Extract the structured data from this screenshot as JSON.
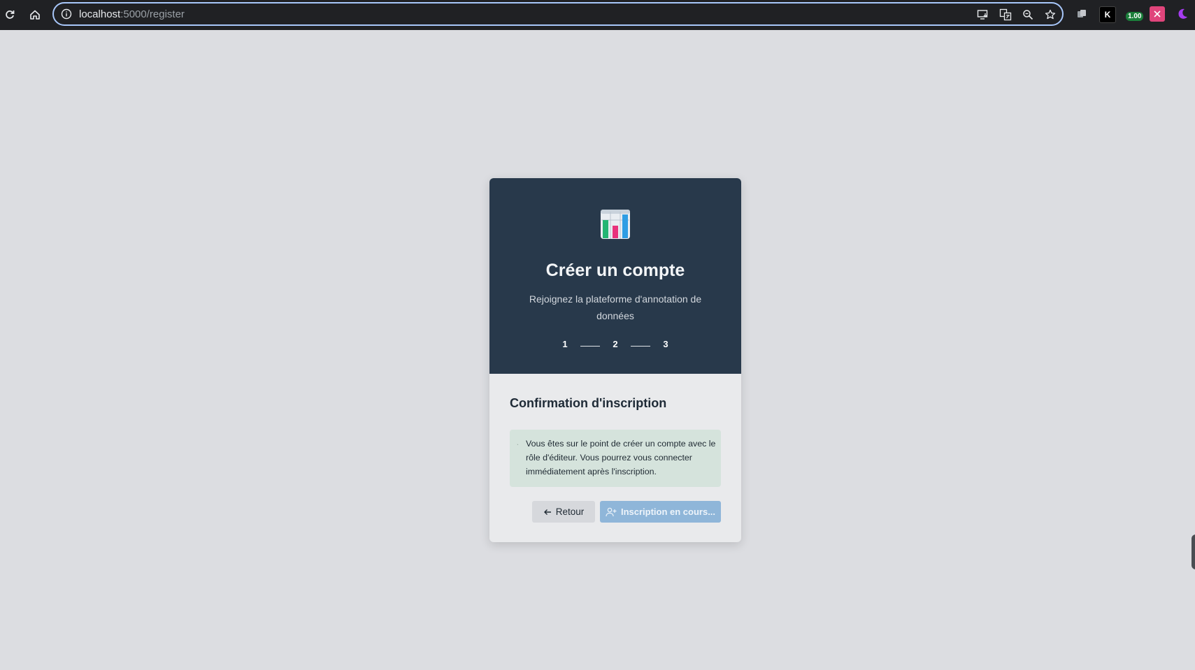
{
  "browser": {
    "url_host": "localhost",
    "url_path": ":5000/register",
    "extension_badge": "1.00",
    "colors": {
      "toolbar": "#202124",
      "omnibox_border": "#a8c7fa"
    }
  },
  "header": {
    "title": "Créer un compte",
    "subtitle": "Rejoignez la plateforme d'annotation de données",
    "steps": [
      "1",
      "2",
      "3"
    ],
    "logo_icon": "bar-chart-logo-icon"
  },
  "body": {
    "section_title": "Confirmation d'inscription",
    "check_mark": "ˎ",
    "info_text": "Vous êtes sur le point de créer un compte avec le rôle d'éditeur. Vous pourrez vous connecter immédiatement après l'inscription.",
    "back_label": "Retour",
    "submit_label": "Inscription en cours..."
  },
  "colors": {
    "page_background": "#dcdde1",
    "header_background": "#28394b",
    "info_box_background": "#d5e3dc",
    "primary_button": "#8fb6d9"
  }
}
